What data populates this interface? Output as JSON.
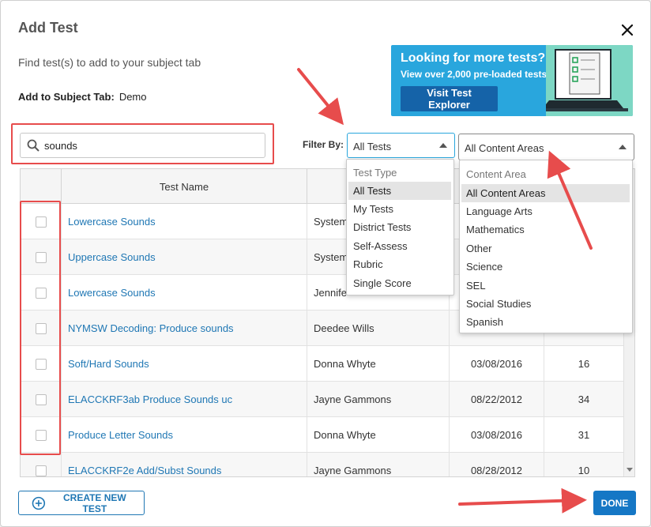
{
  "modal": {
    "title": "Add Test",
    "subtitle": "Find test(s) to add to your subject tab",
    "subject_tab_label": "Add to Subject Tab:",
    "subject_tab_value": "Demo"
  },
  "promo": {
    "title": "Looking for more tests?",
    "subtitle": "View over 2,000 pre-loaded tests!",
    "button_label": "Visit Test Explorer",
    "bg_color": "#29a6dd",
    "button_color": "#1563a8"
  },
  "search": {
    "value": "sounds",
    "icon": "search-icon"
  },
  "filter": {
    "label": "Filter By:",
    "test_type": {
      "selected": "All Tests",
      "header": "Test Type",
      "options": [
        "All Tests",
        "My Tests",
        "District Tests",
        "Self-Assess",
        "Rubric",
        "Single Score"
      ]
    },
    "content_area": {
      "selected": "All Content Areas",
      "header": "Content Area",
      "options": [
        "All Content Areas",
        "Language Arts",
        "Mathematics",
        "Other",
        "Science",
        "SEL",
        "Social Studies",
        "Spanish"
      ]
    }
  },
  "table": {
    "headers": [
      "Test Name"
    ],
    "rows": [
      {
        "name": "Lowercase Sounds",
        "author": "System",
        "date": "",
        "count": ""
      },
      {
        "name": "Uppercase Sounds",
        "author": "System",
        "date": "",
        "count": ""
      },
      {
        "name": "Lowercase Sounds",
        "author": "Jennife",
        "date": "",
        "count": ""
      },
      {
        "name": "NYMSW Decoding: Produce sounds",
        "author": "Deedee Wills",
        "date": "",
        "count": ""
      },
      {
        "name": "Soft/Hard Sounds",
        "author": "Donna Whyte",
        "date": "03/08/2016",
        "count": "16"
      },
      {
        "name": "ELACCKRF3ab Produce Sounds uc",
        "author": "Jayne Gammons",
        "date": "08/22/2012",
        "count": "34"
      },
      {
        "name": "Produce Letter Sounds",
        "author": "Donna Whyte",
        "date": "03/08/2016",
        "count": "31"
      },
      {
        "name": "ELACCKRF2e Add/Subst Sounds",
        "author": "Jayne Gammons",
        "date": "08/28/2012",
        "count": "10"
      }
    ]
  },
  "footer": {
    "create_label": "CREATE NEW TEST",
    "done_label": "DONE"
  },
  "colors": {
    "link": "#1f77b4",
    "primary": "#1577c5",
    "annotation": "#e74c4c"
  }
}
